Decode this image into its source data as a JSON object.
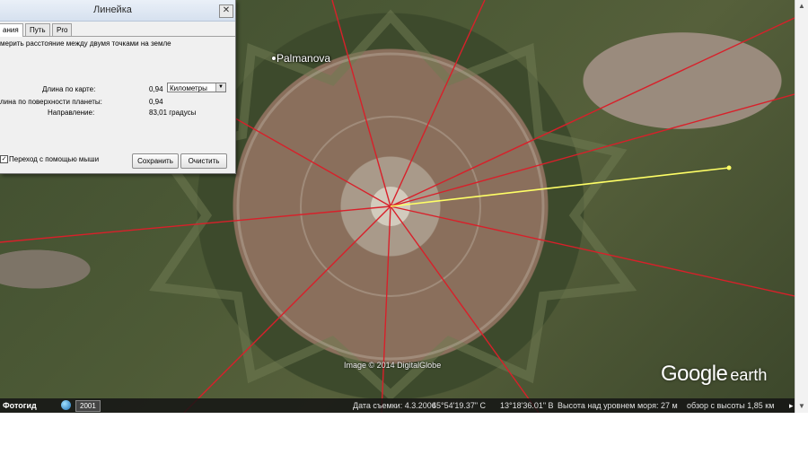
{
  "ruler_dialog": {
    "title": "Линейка",
    "close_glyph": "✕",
    "tabs": [
      "ания",
      "Путь",
      "Pro"
    ],
    "description": "мерить расстояние между двумя точками на земле",
    "map_length_label": "Длина по карте:",
    "map_length_value": "0,94",
    "unit_selected": "Километры",
    "ground_length_label": "лина по поверхности планеты:",
    "ground_length_value": "0,94",
    "heading_label": "Направление:",
    "heading_value": "83,01 градусы",
    "mouse_nav_checked": true,
    "mouse_nav_label": "Переход с помощью мыши",
    "save_button": "Сохранить",
    "clear_button": "Очистить"
  },
  "map": {
    "place_label": "Palmanova",
    "imagery_attribution": "Image © 2014 DigitalGlobe",
    "logo_brand": "Google",
    "logo_product": "earth"
  },
  "status_bar": {
    "logo": "Фотогид",
    "year": "2001",
    "imagery_date": "Дата съемки: 4.3.2006",
    "latitude": "45°54'19.37\" С",
    "longitude": "13°18'36.01\" В",
    "elevation": "Высота над уровнем моря:    27 м",
    "eye_alt": "обзор с высоты    1,85 км",
    "arrow": "▸"
  },
  "colors": {
    "ruler_line": "#ffff66",
    "radial_lines": "#d8202a",
    "dialog_bg": "#f0f0f0"
  }
}
